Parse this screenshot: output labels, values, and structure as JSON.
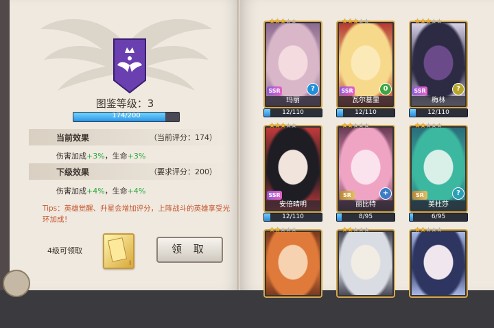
{
  "collection": {
    "level_label": "图鉴等级：3",
    "xp_text": "174/200",
    "xp_fraction": 0.87,
    "current_effect": {
      "label": "当前效果",
      "score_text": "（当前评分：174）",
      "line_prefix": "伤害加成",
      "dmg_bonus": "+3%",
      "sep": "，生命",
      "hp_bonus": "+3%"
    },
    "next_effect": {
      "label": "下级效果",
      "score_text": "（要求评分：200）",
      "line_prefix": "伤害加成",
      "dmg_bonus": "+4%",
      "sep": "，生命",
      "hp_bonus": "+4%"
    },
    "tips": "Tips：英雄觉醒、升星会增加评分，上阵战斗的英雄享受光环加成！",
    "reward_label": "4级可领取",
    "reward_roman": "I",
    "claim_label": "领 取"
  },
  "heroes": [
    {
      "name": "玛丽",
      "rank": "SSR",
      "stars": 3,
      "element": "?",
      "elem_color": "#1f90d8",
      "progress": "12/110",
      "fraction": 0.109,
      "palette": [
        "#d9b7c9",
        "#8c6b8f",
        "#f4dbe0"
      ]
    },
    {
      "name": "瓦尔基里",
      "rank": "SSR",
      "stars": 3,
      "element": "0",
      "elem_color": "#3da640",
      "progress": "12/110",
      "fraction": 0.109,
      "palette": [
        "#f6d98a",
        "#b53a32",
        "#fbe9b8"
      ]
    },
    {
      "name": "梅林",
      "rank": "SSR",
      "stars": 3,
      "element": "?",
      "elem_color": "#b7a62a",
      "progress": "12/110",
      "fraction": 0.109,
      "palette": [
        "#2d2a44",
        "#d8d2e8",
        "#6b4a8a"
      ]
    },
    {
      "name": "安倍晴明",
      "rank": "SSR",
      "stars": 3,
      "element": "",
      "elem_color": "#333",
      "progress": "12/110",
      "fraction": 0.109,
      "palette": [
        "#1e1d24",
        "#c23a3a",
        "#f1e4dc"
      ]
    },
    {
      "name": "丽比特",
      "rank": "SR",
      "stars": 2,
      "element": "+",
      "elem_color": "#3b7cc9",
      "progress": "8/95",
      "fraction": 0.084,
      "palette": [
        "#f0a4c4",
        "#6a3a55",
        "#fbe3ee"
      ]
    },
    {
      "name": "美杜莎",
      "rank": "SR",
      "stars": 2,
      "element": "?",
      "elem_color": "#2a9fb7",
      "progress": "6/95",
      "fraction": 0.063,
      "palette": [
        "#3cb7a0",
        "#2b6c7a",
        "#d8f0e8"
      ]
    },
    {
      "name": "",
      "rank": "",
      "stars": 2,
      "element": "",
      "elem_color": "#333",
      "progress": "",
      "fraction": 0,
      "palette": [
        "#e07a3a",
        "#7a3a1e",
        "#f6d2b0"
      ]
    },
    {
      "name": "",
      "rank": "",
      "stars": 2,
      "element": "",
      "elem_color": "#333",
      "progress": "",
      "fraction": 0,
      "palette": [
        "#d9dce2",
        "#4a4a58",
        "#f1ece4"
      ]
    },
    {
      "name": "",
      "rank": "",
      "stars": 2,
      "element": "",
      "elem_color": "#333",
      "progress": "",
      "fraction": 0,
      "palette": [
        "#2d3560",
        "#a8b8e8",
        "#f0e6ee"
      ]
    }
  ]
}
